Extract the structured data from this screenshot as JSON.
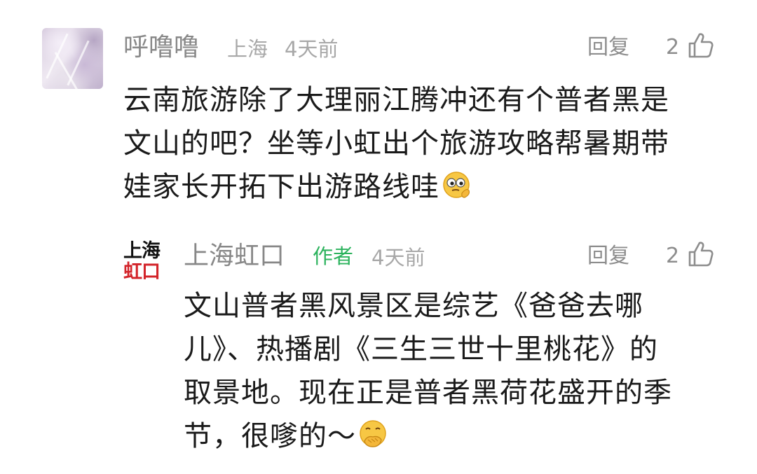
{
  "comments": [
    {
      "username": "呼噜噜",
      "location": "上海",
      "time": "4天前",
      "reply_label": "回复",
      "likes": "2",
      "text_lines": [
        "云南旅游除了大理丽江腾冲还有个普者黑是",
        "文山的吧？坐等小虹出个旅游攻略帮暑期带",
        "娃家长开拓下出游路线哇"
      ],
      "emoji": "thinking-face-emoji"
    },
    {
      "username": "上海虹口",
      "author_tag": "作者",
      "time": "4天前",
      "reply_label": "回复",
      "likes": "2",
      "avatar_logo": {
        "line1": "上海",
        "line2": "虹口"
      },
      "text_lines": [
        "文山普者黑风景区是综艺《爸爸去哪",
        "儿》、热播剧《三生三世十里桃花》的",
        "取景地。现在正是普者黑荷花盛开的季",
        "节，很嗲的～"
      ],
      "emoji": "hand-over-mouth-emoji"
    }
  ],
  "colors": {
    "username": "#888888",
    "meta": "#a8a8a8",
    "author_tag": "#2db35e",
    "body": "#1a1a1a",
    "logo_red": "#d3242a"
  }
}
